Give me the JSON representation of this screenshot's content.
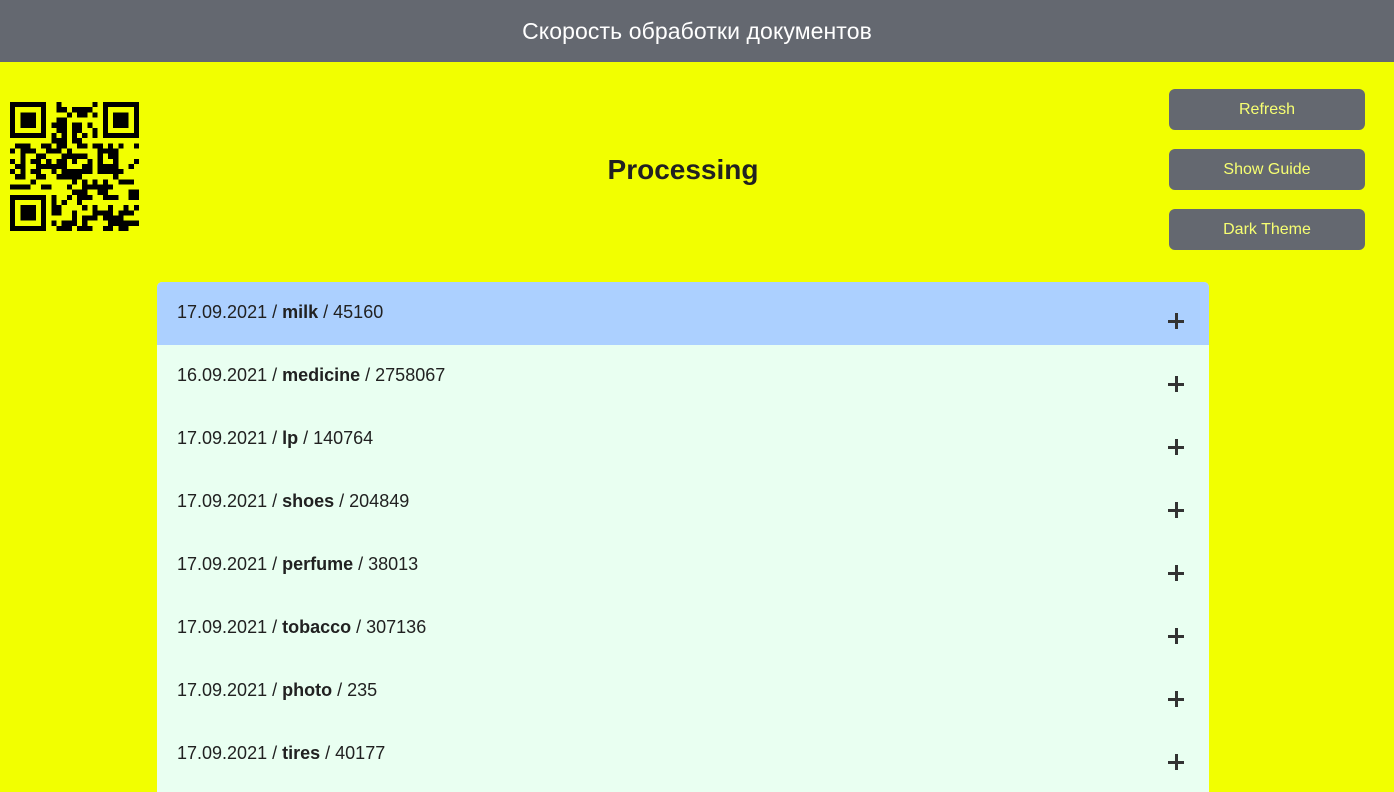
{
  "header": {
    "title": "Скорость обработки документов"
  },
  "main": {
    "title": "Processing"
  },
  "toolbar": {
    "refresh_label": "Refresh",
    "guide_label": "Show Guide",
    "theme_label": "Dark Theme"
  },
  "rows": [
    {
      "date": "17.09.2021",
      "category": "milk",
      "count": "45160",
      "active": true
    },
    {
      "date": "16.09.2021",
      "category": "medicine",
      "count": "2758067"
    },
    {
      "date": "17.09.2021",
      "category": "lp",
      "count": "140764"
    },
    {
      "date": "17.09.2021",
      "category": "shoes",
      "count": "204849"
    },
    {
      "date": "17.09.2021",
      "category": "perfume",
      "count": "38013"
    },
    {
      "date": "17.09.2021",
      "category": "tobacco",
      "count": "307136"
    },
    {
      "date": "17.09.2021",
      "category": "photo",
      "count": "235"
    },
    {
      "date": "17.09.2021",
      "category": "tires",
      "count": "40177"
    }
  ],
  "icons": {
    "row_expand": "plus-icon",
    "qr": "qr-code-icon"
  },
  "colors": {
    "background": "#f2ff00",
    "topbar": "#646870",
    "button_text": "#f7ff72",
    "list_bg": "#e9fff1",
    "active_row": "#acd0ff"
  }
}
